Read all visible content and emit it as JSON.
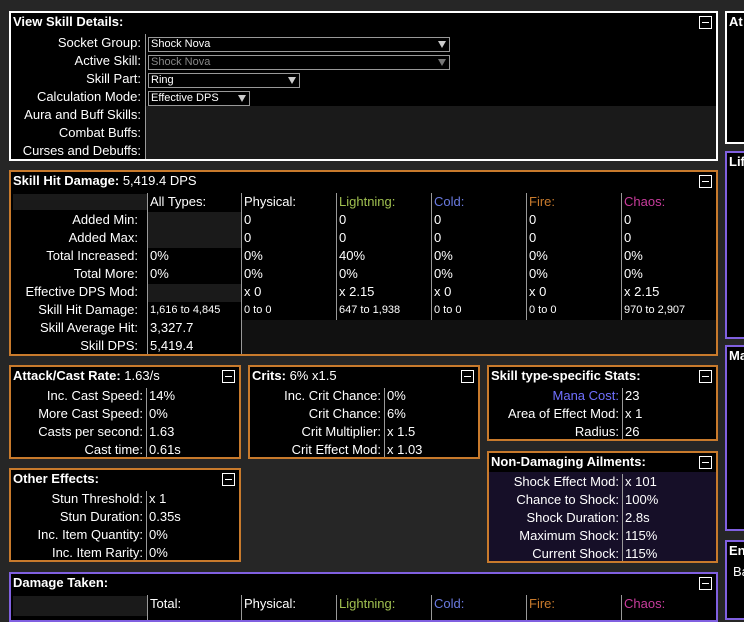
{
  "view": {
    "title": "View Skill Details:",
    "rows": {
      "socket_group": {
        "label": "Socket Group:",
        "value": "Shock Nova"
      },
      "active_skill": {
        "label": "Active Skill:",
        "value": "Shock Nova"
      },
      "skill_part": {
        "label": "Skill Part:",
        "value": "Ring"
      },
      "calc_mode": {
        "label": "Calculation Mode:",
        "value": "Effective DPS"
      },
      "aura": {
        "label": "Aura and Buff Skills:"
      },
      "combat": {
        "label": "Combat Buffs:"
      },
      "curses": {
        "label": "Curses and Debuffs:"
      }
    }
  },
  "side": {
    "at": "At",
    "life": "Lif",
    "ma": "Ma",
    "en": "En",
    "ba": "Ba"
  },
  "hit": {
    "title": "Skill Hit Damage:",
    "dps": "5,419.4 DPS",
    "columns": {
      "all": "All Types:",
      "physical": "Physical:",
      "lightning": "Lightning:",
      "cold": "Cold:",
      "fire": "Fire:",
      "chaos": "Chaos:"
    },
    "rows": {
      "added_min": {
        "label": "Added Min:",
        "physical": "0",
        "lightning": "0",
        "cold": "0",
        "fire": "0",
        "chaos": "0"
      },
      "added_max": {
        "label": "Added Max:",
        "physical": "0",
        "lightning": "0",
        "cold": "0",
        "fire": "0",
        "chaos": "0"
      },
      "total_inc": {
        "label": "Total Increased:",
        "all": "0%",
        "physical": "0%",
        "lightning": "40%",
        "cold": "0%",
        "fire": "0%",
        "chaos": "0%"
      },
      "total_more": {
        "label": "Total More:",
        "all": "0%",
        "physical": "0%",
        "lightning": "0%",
        "cold": "0%",
        "fire": "0%",
        "chaos": "0%"
      },
      "eff_dps": {
        "label": "Effective DPS Mod:",
        "physical": "x 0",
        "lightning": "x 2.15",
        "cold": "x 0",
        "fire": "x 0",
        "chaos": "x 2.15"
      },
      "hit_dmg": {
        "label": "Skill Hit Damage:",
        "all": "1,616 to 4,845",
        "physical": "0 to 0",
        "lightning": "647 to 1,938",
        "cold": "0 to 0",
        "fire": "0 to 0",
        "chaos": "970 to 2,907"
      },
      "avg_hit": {
        "label": "Skill Average Hit:",
        "all": "3,327.7"
      },
      "skill_dps": {
        "label": "Skill DPS:",
        "all": "5,419.4"
      }
    }
  },
  "rate": {
    "title": "Attack/Cast Rate:",
    "value": "1.63/s",
    "rows": {
      "inc": {
        "label": "Inc. Cast Speed:",
        "value": "14%"
      },
      "more": {
        "label": "More Cast Speed:",
        "value": "0%"
      },
      "cps": {
        "label": "Casts per second:",
        "value": "1.63"
      },
      "time": {
        "label": "Cast time:",
        "value": "0.61s"
      }
    }
  },
  "crits": {
    "title": "Crits:",
    "value": "6% x1.5",
    "rows": {
      "inc": {
        "label": "Inc. Crit Chance:",
        "value": "0%"
      },
      "chance": {
        "label": "Crit Chance:",
        "value": "6%"
      },
      "mult": {
        "label": "Crit Multiplier:",
        "value": "x 1.5"
      },
      "eff": {
        "label": "Crit Effect Mod:",
        "value": "x 1.03"
      }
    }
  },
  "type": {
    "title": "Skill type-specific Stats:",
    "rows": {
      "mana": {
        "label": "Mana Cost:",
        "value": "23"
      },
      "aoe": {
        "label": "Area of Effect Mod:",
        "value": "x 1"
      },
      "radius": {
        "label": "Radius:",
        "value": "26"
      }
    }
  },
  "other": {
    "title": "Other Effects:",
    "rows": {
      "stun_thr": {
        "label": "Stun Threshold:",
        "value": "x 1"
      },
      "stun_dur": {
        "label": "Stun Duration:",
        "value": "0.35s"
      },
      "iiq": {
        "label": "Inc. Item Quantity:",
        "value": "0%"
      },
      "iir": {
        "label": "Inc. Item Rarity:",
        "value": "0%"
      }
    }
  },
  "ailments": {
    "title": "Non-Damaging Ailments:",
    "rows": {
      "shock_eff": {
        "label": "Shock Effect Mod:",
        "value": "x 101"
      },
      "chance": {
        "label": "Chance to Shock:",
        "value": "100%"
      },
      "dur": {
        "label": "Shock Duration:",
        "value": "2.8s"
      },
      "max": {
        "label": "Maximum Shock:",
        "value": "115%"
      },
      "cur": {
        "label": "Current Shock:",
        "value": "115%"
      }
    }
  },
  "taken": {
    "title": "Damage Taken:",
    "columns": {
      "total": "Total:",
      "physical": "Physical:",
      "lightning": "Lightning:",
      "cold": "Cold:",
      "fire": "Fire:",
      "chaos": "Chaos:"
    }
  },
  "colors": {
    "lightning": "#a0c050",
    "cold": "#6a7ae0",
    "fire": "#c87a2c",
    "chaos": "#c83c9c",
    "mana": "#7070ff",
    "orange_border": "#c87a2c",
    "purple_border": "#8060e0"
  }
}
